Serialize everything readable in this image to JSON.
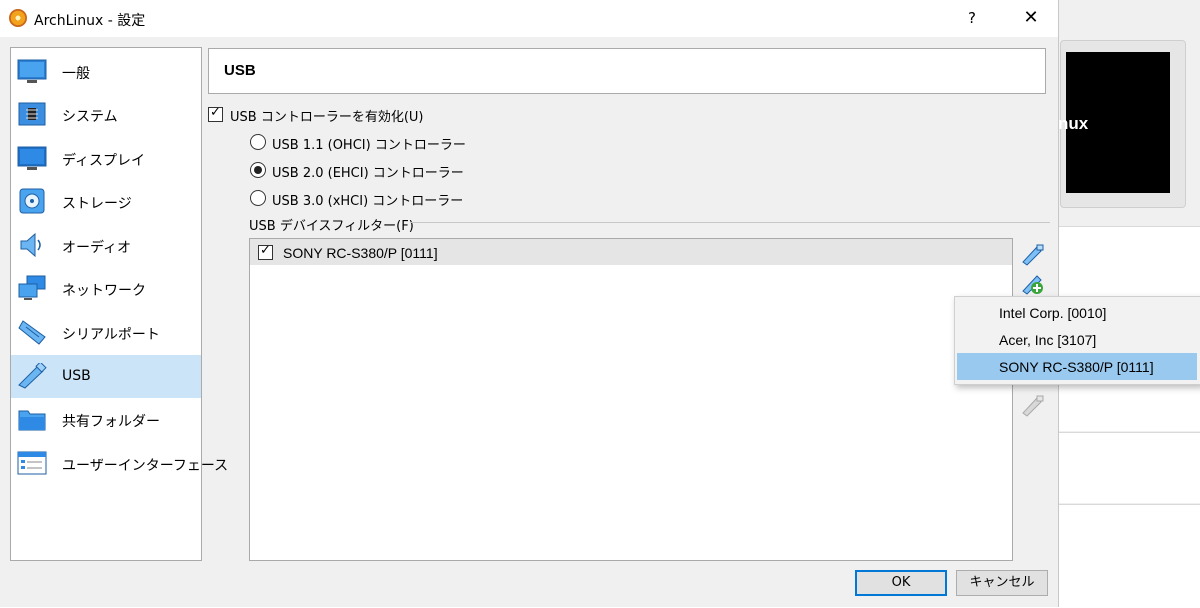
{
  "window": {
    "title": "ArchLinux - 設定",
    "help": "?",
    "close": "✕"
  },
  "background": {
    "preview_text": "nux"
  },
  "sidebar": {
    "items": [
      {
        "label": "一般",
        "icon": "general-icon"
      },
      {
        "label": "システム",
        "icon": "system-icon"
      },
      {
        "label": "ディスプレイ",
        "icon": "display-icon"
      },
      {
        "label": "ストレージ",
        "icon": "storage-icon"
      },
      {
        "label": "オーディオ",
        "icon": "audio-icon"
      },
      {
        "label": "ネットワーク",
        "icon": "network-icon"
      },
      {
        "label": "シリアルポート",
        "icon": "serial-port-icon"
      },
      {
        "label": "USB",
        "icon": "usb-icon",
        "selected": true
      },
      {
        "label": "共有フォルダー",
        "icon": "shared-folder-icon"
      },
      {
        "label": "ユーザーインターフェース",
        "icon": "user-interface-icon"
      }
    ]
  },
  "section": {
    "title": "USB"
  },
  "usb": {
    "enable_label": "USB コントローラーを有効化(U)",
    "enabled": true,
    "controllers": [
      {
        "label": "USB 1.1 (OHCI) コントローラー",
        "selected": false
      },
      {
        "label": "USB 2.0 (EHCI) コントローラー",
        "selected": true
      },
      {
        "label": "USB 3.0 (xHCI) コントローラー",
        "selected": false
      }
    ],
    "filter_label": "USB デバイスフィルター(F)",
    "filters": [
      {
        "label": "SONY RC-S380/P [0111]",
        "checked": true
      }
    ]
  },
  "device_menu": {
    "items": [
      {
        "label": "Intel Corp.  [0010]"
      },
      {
        "label": "Acer, Inc  [3107]"
      },
      {
        "label": "SONY RC-S380/P [0111]",
        "highlight": true
      }
    ]
  },
  "buttons": {
    "ok": "OK",
    "cancel": "キャンセル"
  },
  "colors": {
    "selection": "#cce4f7",
    "menu_highlight": "#99c9ef",
    "accent": "#0078d7"
  }
}
